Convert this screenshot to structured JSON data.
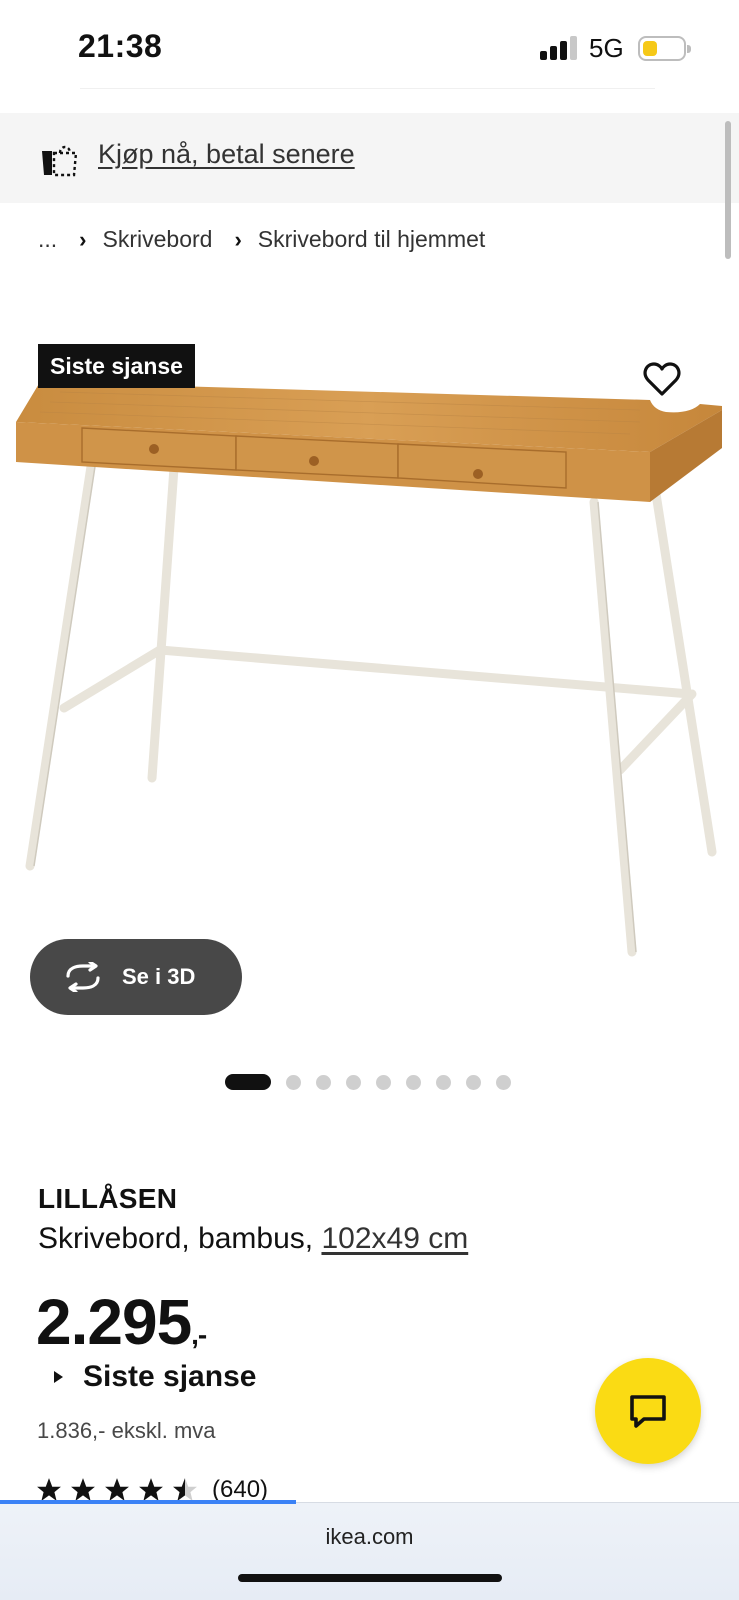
{
  "status_bar": {
    "time": "21:38",
    "network": "5G",
    "signal_bars_active": 3,
    "battery_level": 0.25,
    "battery_color": "#f6c918"
  },
  "promo": {
    "icon": "bnpl-icon",
    "link_text": "Kjøp nå, betal senere"
  },
  "breadcrumb": {
    "ellipsis": "...",
    "items": [
      "Skrivebord",
      "Skrivebord til hjemmet"
    ]
  },
  "product_image": {
    "badge": "Siste sjanse",
    "favorite_icon": "heart-icon",
    "view_3d_label": "Se i 3D",
    "image_count": 9,
    "active_index": 0
  },
  "product": {
    "name": "LILLÅSEN",
    "description": "Skrivebord, bambus, ",
    "size": "102x49 cm",
    "price": "2.295",
    "price_suffix": ",-",
    "last_chance": "Siste sjanse",
    "excl_vat": "1.836,- ekskl. mva",
    "rating": 4.5,
    "review_count": "(640)"
  },
  "chat": {
    "icon": "chat-icon",
    "color": "#fadb14"
  },
  "browser": {
    "url": "ikea.com",
    "load_progress": 0.4,
    "progress_color": "#3b82f6"
  }
}
